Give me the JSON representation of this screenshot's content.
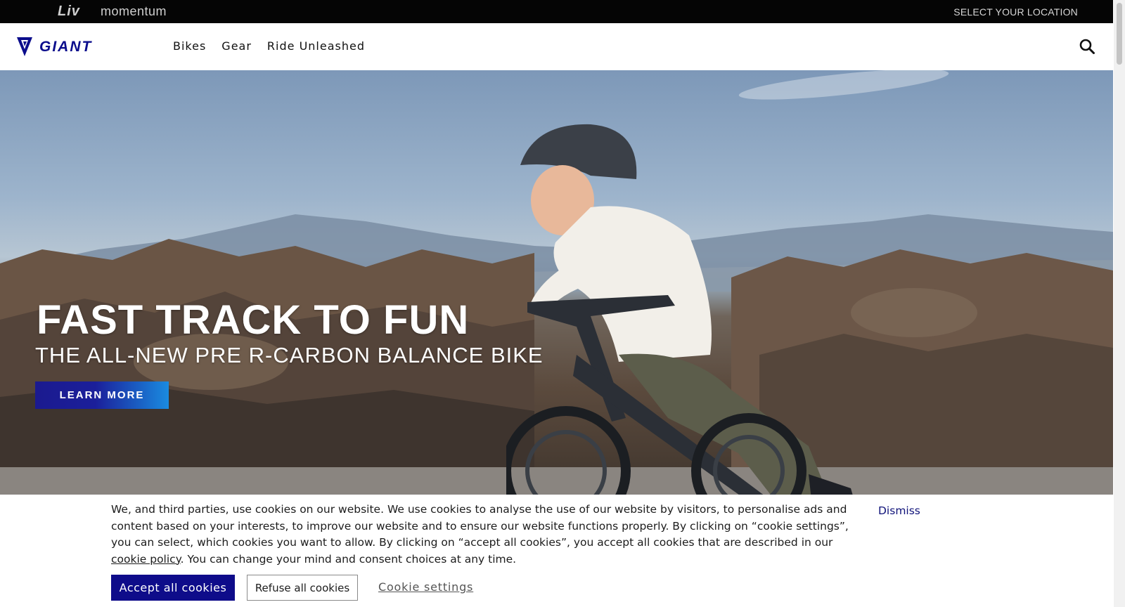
{
  "topbar": {
    "brands": [
      "Liv",
      "momentum"
    ],
    "location_link": "SELECT YOUR LOCATION"
  },
  "header": {
    "logo_text": "GIANT",
    "nav": [
      "Bikes",
      "Gear",
      "Ride Unleashed"
    ],
    "search_icon": "search-icon"
  },
  "hero": {
    "title": "FAST TRACK TO FUN",
    "subtitle": "THE ALL-NEW PRE R-CARBON BALANCE BIKE",
    "cta_label": "LEARN MORE"
  },
  "cookie_banner": {
    "text_before_link": "We, and third parties, use cookies on our website. We use cookies to analyse the use of our website by visitors, to personalise ads and content based on your interests, to improve our website and to ensure our website functions properly. By clicking on “cookie settings”, you can select, which cookies you want to allow. By clicking on “accept all cookies”, you accept all cookies that are described in our ",
    "policy_link": "cookie policy",
    "text_after_link": ". You can change your mind and consent choices at any time.",
    "dismiss": "Dismiss",
    "accept_label": "Accept all cookies",
    "refuse_label": "Refuse all cookies",
    "settings_label": "Cookie settings"
  },
  "colors": {
    "brand_blue": "#0e0c8a",
    "topbar_bg": "#050505",
    "cta_gradient_end": "#1a8be0"
  }
}
